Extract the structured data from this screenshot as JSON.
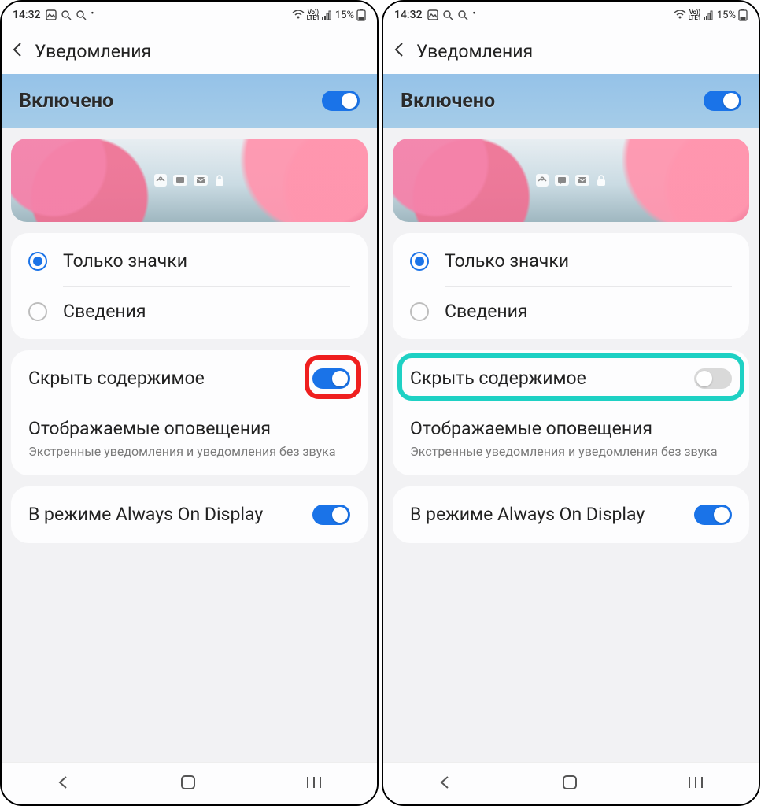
{
  "status": {
    "time": "14:32",
    "battery_pct": "15%",
    "lte_top": "Vo))",
    "lte_bot": "LTE1"
  },
  "header": {
    "title": "Уведомления"
  },
  "master_toggle": {
    "label": "Включено",
    "on": true
  },
  "radios": {
    "opt1": "Только значки",
    "opt2": "Сведения",
    "selected": 0
  },
  "hide_content": {
    "label": "Скрыть содержимое",
    "left_on": true,
    "right_on": false
  },
  "alerts": {
    "title": "Отображаемые оповещения",
    "sub": "Экстренные уведомления и уведомления без звука"
  },
  "aod": {
    "label": "В режиме Always On Display",
    "on": true
  },
  "highlight": {
    "left_color": "#ef1f1f",
    "right_color": "#1ed1c4"
  }
}
